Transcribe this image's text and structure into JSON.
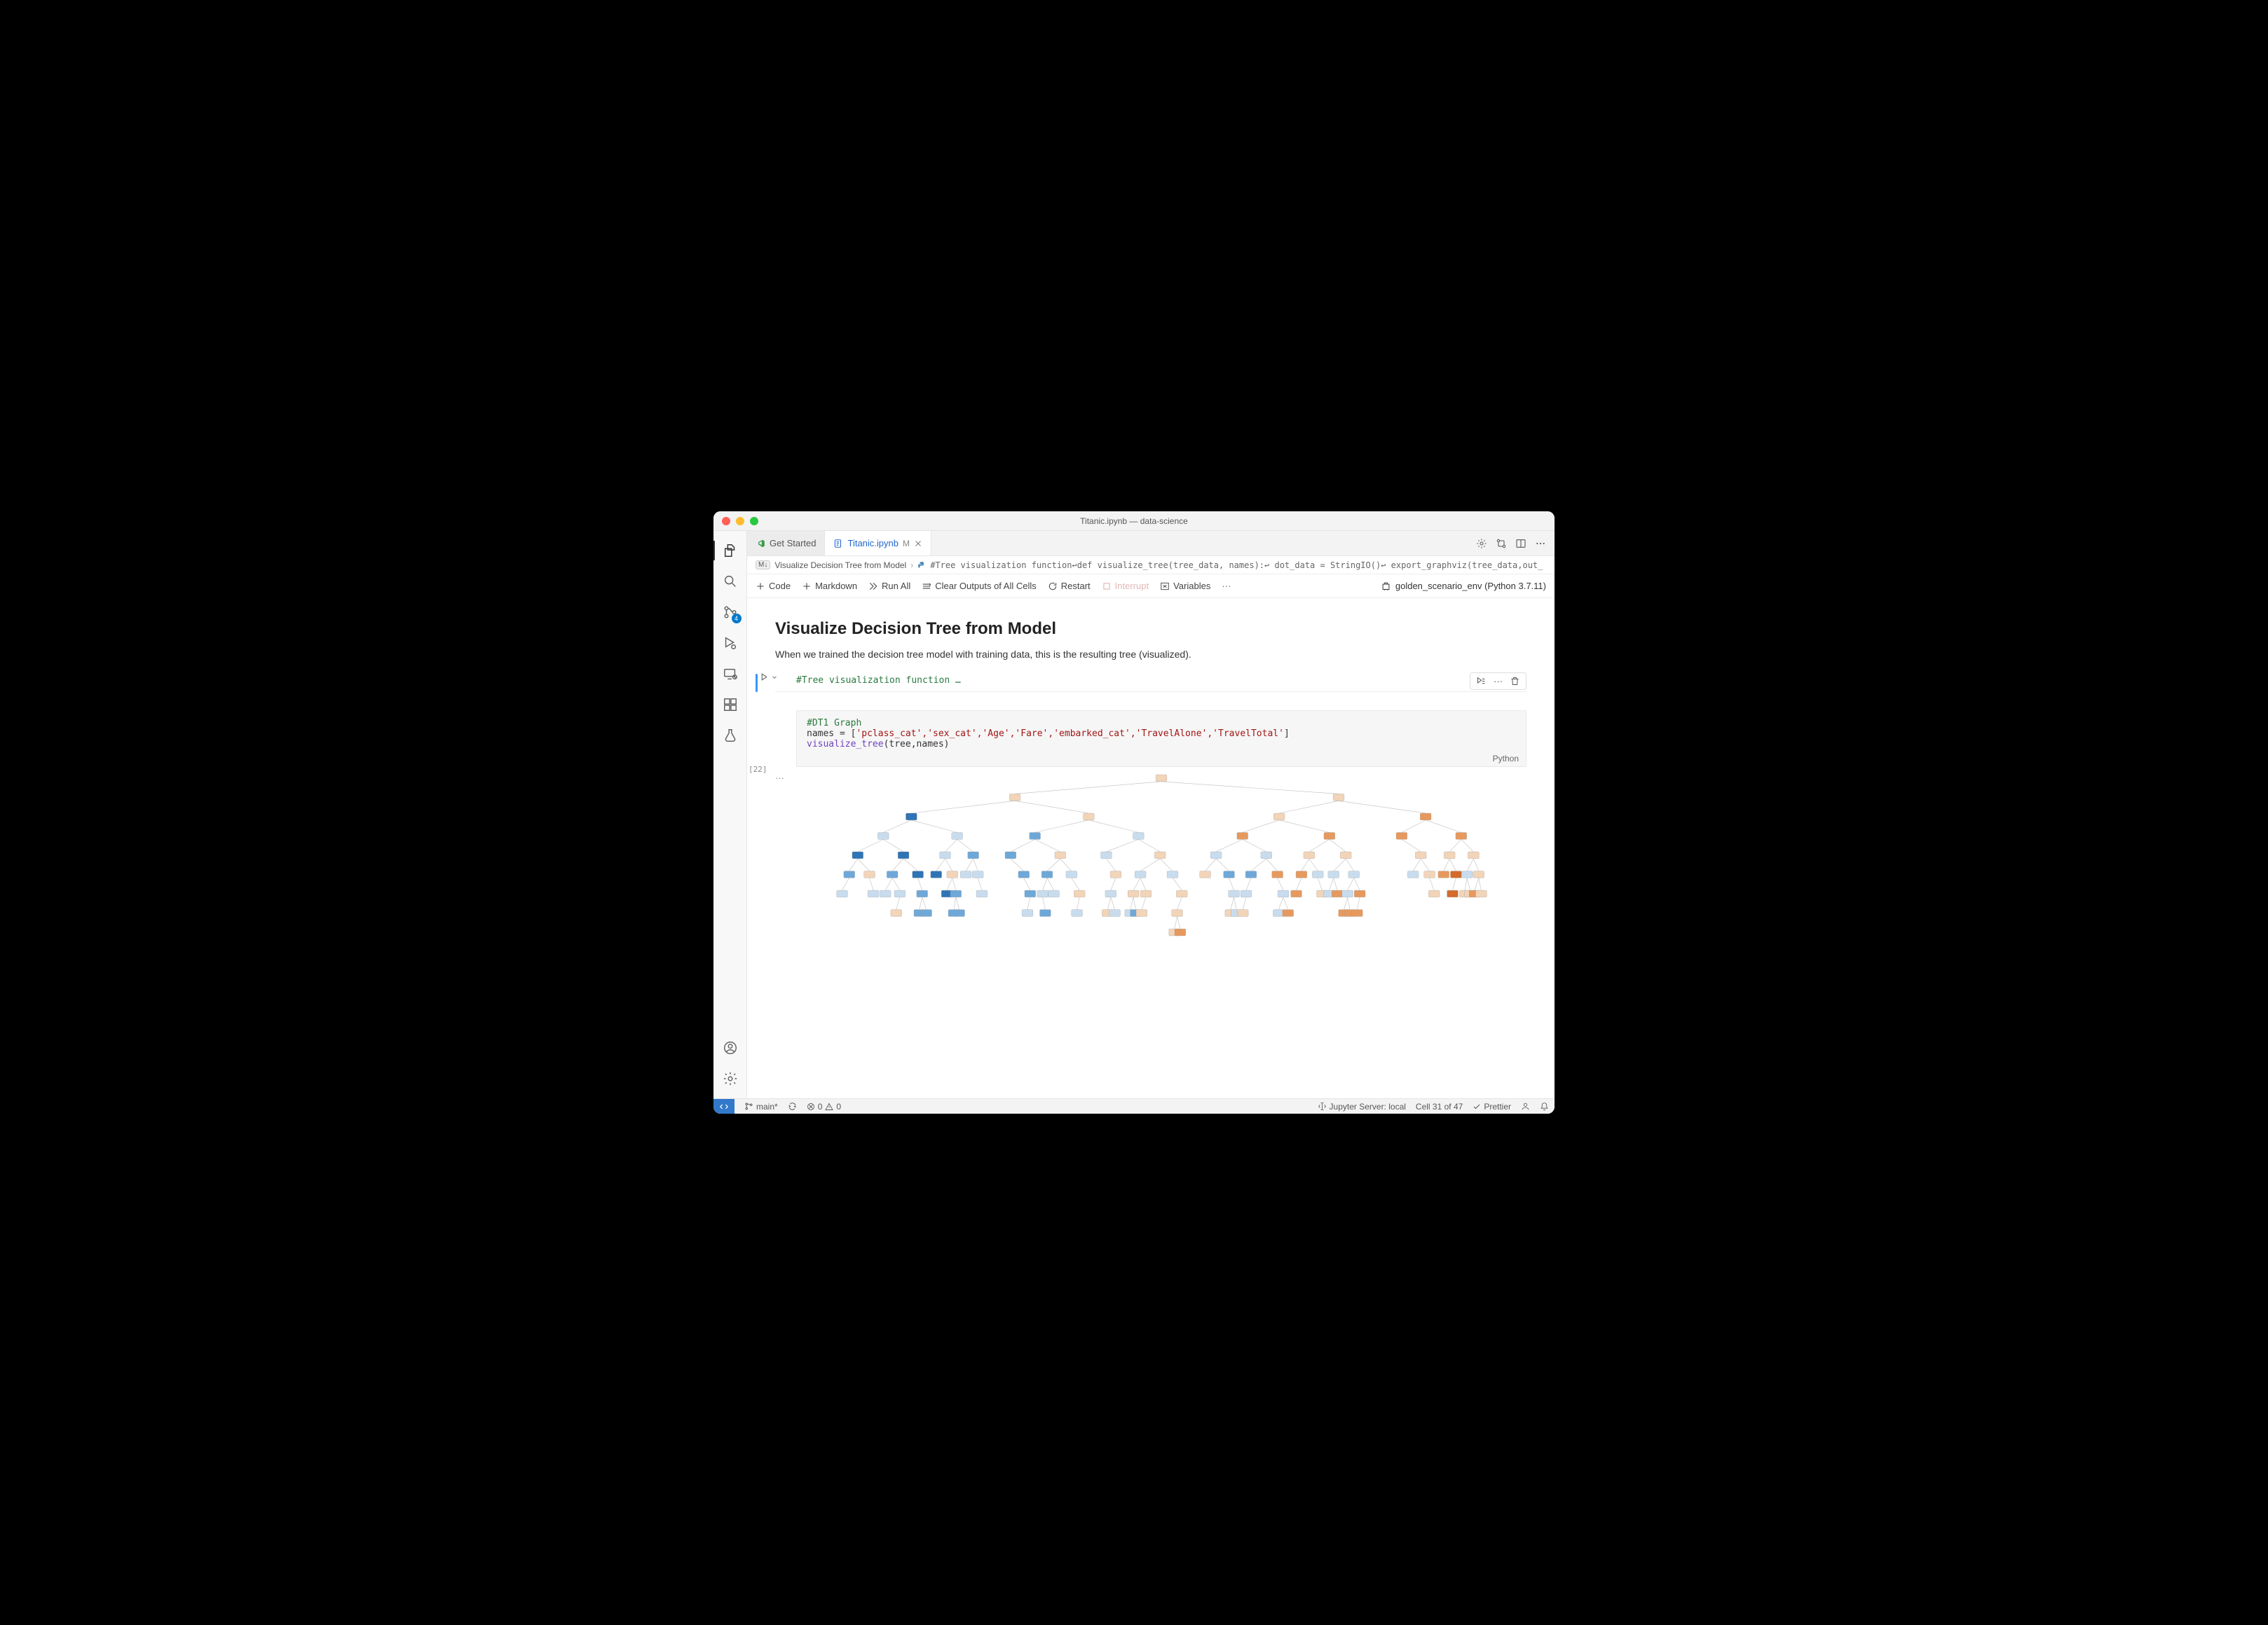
{
  "window_title": "Titanic.ipynb — data-science",
  "tabs": [
    {
      "label": "Get Started",
      "active": false
    },
    {
      "label": "Titanic.ipynb",
      "active": true,
      "dirty_marker": "M"
    }
  ],
  "breadcrumb": {
    "md_icon": "M↓",
    "section": "Visualize Decision Tree from Model",
    "code_preview": "#Tree visualization function↩def visualize_tree(tree_data, names):↩   dot_data = StringIO()↩   export_graphviz(tree_data,out_"
  },
  "nb_toolbar": {
    "code": "Code",
    "markdown": "Markdown",
    "run_all": "Run All",
    "clear_outputs": "Clear Outputs of All Cells",
    "restart": "Restart",
    "interrupt": "Interrupt",
    "variables": "Variables"
  },
  "kernel_label": "golden_scenario_env (Python 3.7.11)",
  "markdown_cell": {
    "heading": "Visualize Decision Tree from Model",
    "paragraph": "When we trained the decision tree model with training data, this is the resulting tree (visualized)."
  },
  "collapsed_cell_preview": "#Tree visualization function …",
  "code_cell": {
    "exec_count": "[22]",
    "line1_comment": "#DT1 Graph",
    "line2_pre": "names = [",
    "line2_items": "'pclass_cat','sex_cat','Age','Fare','embarked_cat','TravelAlone','TravelTotal'",
    "line2_post": "]",
    "line3_fn": "visualize_tree",
    "line3_args": "(tree,names)",
    "language": "Python"
  },
  "activity_badge": "4",
  "status_bar": {
    "branch": "main*",
    "errors": "0",
    "warnings": "0",
    "jupyter": "Jupyter Server: local",
    "cell_pos": "Cell 31 of 47",
    "prettier": "Prettier"
  },
  "tree_colors": {
    "blue_dark": "#2f74b5",
    "blue_mid": "#6ea8d8",
    "blue_light": "#c8dcee",
    "orange_dark": "#d46b2c",
    "orange_mid": "#e6995e",
    "orange_light": "#f2d4b8",
    "edge": "#bdbdbd"
  }
}
